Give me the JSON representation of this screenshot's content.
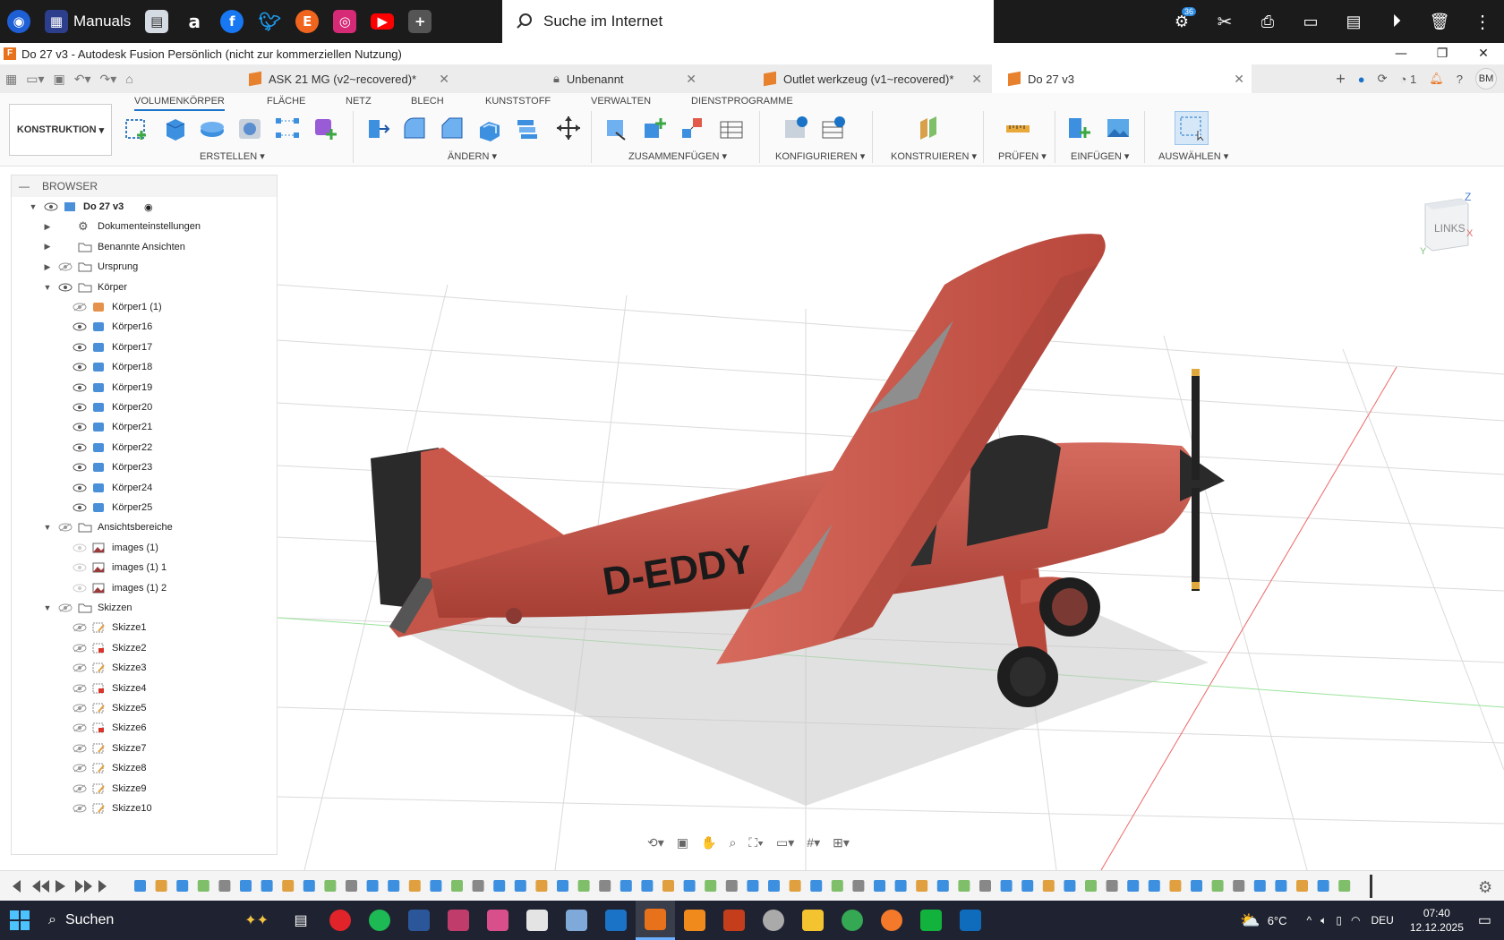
{
  "taskbar_top": {
    "manuals_label": "Manuals",
    "search_placeholder": "Suche im Internet",
    "notification_count": "36"
  },
  "window": {
    "title": "Do 27 v3 - Autodesk Fusion Persönlich (nicht zur kommerziellen Nutzung)"
  },
  "tabs": [
    {
      "label": "ASK 21 MG (v2~recovered)*"
    },
    {
      "label": "Unbenannt"
    },
    {
      "label": "Outlet werkzeug (v1~recovered)*"
    },
    {
      "label": "Do 27 v3"
    }
  ],
  "tabbar_right": {
    "job_count": "1",
    "avatar": "BM"
  },
  "ribbon": {
    "workspace": "KONSTRUKTION",
    "tabs": [
      "VOLUMENKÖRPER",
      "FLÄCHE",
      "NETZ",
      "BLECH",
      "KUNSTSTOFF",
      "VERWALTEN",
      "DIENSTPROGRAMME"
    ],
    "groups": [
      "ERSTELLEN",
      "ÄNDERN",
      "ZUSAMMENFÜGEN",
      "KONFIGURIEREN",
      "KONSTRUIEREN",
      "PRÜFEN",
      "EINFÜGEN",
      "AUSWÄHLEN"
    ]
  },
  "browser": {
    "title": "BROWSER",
    "root": "Do 27 v3",
    "items": [
      {
        "label": "Dokumenteinstellungen"
      },
      {
        "label": "Benannte Ansichten"
      },
      {
        "label": "Ursprung"
      },
      {
        "label": "Körper"
      },
      {
        "label": "Körper1 (1)"
      },
      {
        "label": "Körper16"
      },
      {
        "label": "Körper17"
      },
      {
        "label": "Körper18"
      },
      {
        "label": "Körper19"
      },
      {
        "label": "Körper20"
      },
      {
        "label": "Körper21"
      },
      {
        "label": "Körper22"
      },
      {
        "label": "Körper23"
      },
      {
        "label": "Körper24"
      },
      {
        "label": "Körper25"
      },
      {
        "label": "Ansichtsbereiche"
      },
      {
        "label": "images (1)"
      },
      {
        "label": "images (1) 1"
      },
      {
        "label": "images (1) 2"
      },
      {
        "label": "Skizzen"
      },
      {
        "label": "Skizze1"
      },
      {
        "label": "Skizze2"
      },
      {
        "label": "Skizze3"
      },
      {
        "label": "Skizze4"
      },
      {
        "label": "Skizze5"
      },
      {
        "label": "Skizze6"
      },
      {
        "label": "Skizze7"
      },
      {
        "label": "Skizze8"
      },
      {
        "label": "Skizze9"
      },
      {
        "label": "Skizze10"
      }
    ]
  },
  "viewport": {
    "registration": "D-EDDY",
    "viewcube_face": "LINKS",
    "axis_z": "Z",
    "axis_y": "Y",
    "axis_x": "X"
  },
  "taskbar_bottom": {
    "search_label": "Suchen",
    "temperature": "6°C",
    "language": "DEU",
    "time": "07:40",
    "date": "12.12.2025"
  },
  "colors": {
    "accent": "#1a73c6",
    "plane_red": "#c9574a",
    "fusion_orange": "#e8721c"
  }
}
